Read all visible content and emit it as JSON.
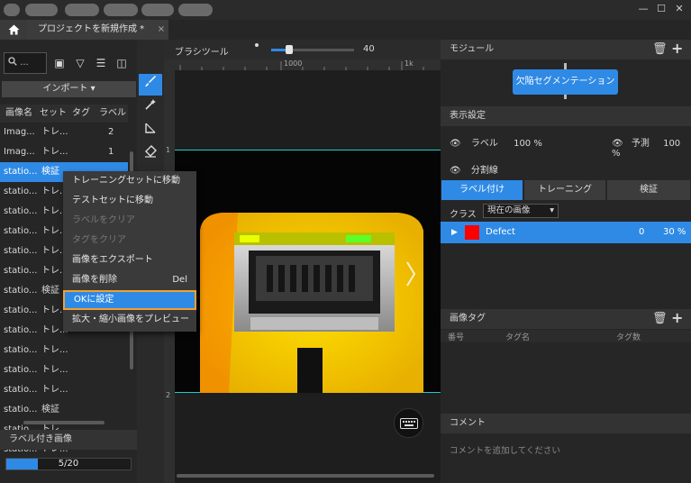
{
  "titlebar": {
    "menu_count": 6,
    "window_buttons": [
      "—",
      "☐",
      "✕"
    ]
  },
  "tab": {
    "title": "プロジェクトを新規作成 *",
    "close": "×"
  },
  "left_panel": {
    "search_placeholder": "...",
    "import_label": "インポート",
    "columns": [
      "画像名",
      "セット",
      "タグ",
      "ラベル"
    ],
    "rows": [
      {
        "name": "Imag...",
        "set": "トレ...",
        "tag": "",
        "label": "2"
      },
      {
        "name": "Imag...",
        "set": "トレ...",
        "tag": "",
        "label": "1"
      },
      {
        "name": "statio...",
        "set": "検証",
        "tag": "",
        "label": ""
      },
      {
        "name": "statio...",
        "set": "トレ...",
        "tag": "",
        "label": ""
      },
      {
        "name": "statio...",
        "set": "トレ...",
        "tag": "",
        "label": ""
      },
      {
        "name": "statio...",
        "set": "トレ...",
        "tag": "",
        "label": ""
      },
      {
        "name": "statio...",
        "set": "トレ...",
        "tag": "",
        "label": ""
      },
      {
        "name": "statio...",
        "set": "トレ...",
        "tag": "",
        "label": ""
      },
      {
        "name": "statio...",
        "set": "検証",
        "tag": "",
        "label": ""
      },
      {
        "name": "statio...",
        "set": "トレ...",
        "tag": "",
        "label": ""
      },
      {
        "name": "statio...",
        "set": "トレ...",
        "tag": "",
        "label": ""
      },
      {
        "name": "statio...",
        "set": "トレ...",
        "tag": "",
        "label": ""
      },
      {
        "name": "statio...",
        "set": "トレ...",
        "tag": "",
        "label": ""
      },
      {
        "name": "statio...",
        "set": "トレ...",
        "tag": "",
        "label": ""
      },
      {
        "name": "statio...",
        "set": "検証",
        "tag": "",
        "label": ""
      },
      {
        "name": "statio...",
        "set": "トレ...",
        "tag": "",
        "label": ""
      },
      {
        "name": "statio...",
        "set": "トレ...",
        "tag": "",
        "label": ""
      }
    ],
    "selected_row": 2,
    "labeled_images_label": "ラベル付き画像",
    "progress_text": "5/20",
    "progress_fraction": 0.25
  },
  "context_menu": {
    "items": [
      {
        "label": "トレーニングセットに移動",
        "shortcut": "",
        "disabled": false
      },
      {
        "label": "テストセットに移動",
        "shortcut": "",
        "disabled": false
      },
      {
        "label": "ラベルをクリア",
        "shortcut": "",
        "disabled": true
      },
      {
        "label": "タグをクリア",
        "shortcut": "",
        "disabled": true
      },
      {
        "label": "画像をエクスポート",
        "shortcut": "",
        "disabled": false
      },
      {
        "label": "画像を削除",
        "shortcut": "Del",
        "disabled": false
      },
      {
        "label": "OKに設定",
        "shortcut": "",
        "disabled": false
      },
      {
        "label": "拡大・縮小画像をプレビュー",
        "shortcut": "",
        "disabled": false
      }
    ],
    "highlighted_index": 6
  },
  "canvas": {
    "brush_tool_label": "ブラシツール",
    "brush_size": "40",
    "brush_fraction": 0.22,
    "ruler_h": [
      "1000",
      "1k"
    ],
    "ruler_v": [
      "1",
      "2"
    ]
  },
  "right_panel": {
    "module_header": "モジュール",
    "module_button": "欠陥セグメンテーション",
    "display_header": "表示設定",
    "label_toggle": "ラベル",
    "label_pct": "100 %",
    "pred_toggle": "予測",
    "pred_pct": "100 %",
    "split_line": "分割線",
    "tabs": [
      "ラベル付け",
      "トレーニング",
      "検証"
    ],
    "active_tab": 0,
    "class_label": "クラス",
    "class_select": "現在の画像",
    "class_row": {
      "name": "Defect",
      "count": "0",
      "pct": "30 %",
      "color": "#ff0000"
    },
    "image_tag_header": "画像タグ",
    "tag_columns": [
      "番号",
      "タグ名",
      "タグ数"
    ],
    "comment_header": "コメント",
    "comment_placeholder": "コメントを追加してください"
  },
  "colors": {
    "accent": "#2f8ae6",
    "highlight_border": "#f0a030"
  }
}
